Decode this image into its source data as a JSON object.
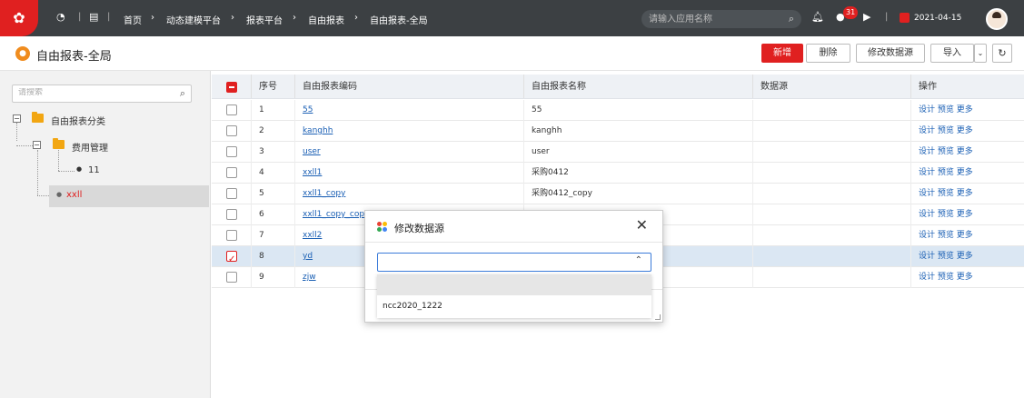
{
  "topbar": {
    "breadcrumbs": [
      "首页",
      "动态建模平台",
      "报表平台",
      "自由报表",
      "自由报表-全局"
    ],
    "search_placeholder": "请输入应用名称",
    "notif_count": "31",
    "date": "2021-04-15"
  },
  "header": {
    "title": "自由报表-全局",
    "buttons": {
      "add": "新增",
      "delete": "删除",
      "modify_ds": "修改数据源",
      "import": "导入"
    }
  },
  "tree": {
    "search_placeholder": "请搜索",
    "root": "自由报表分类",
    "child": "费用管理",
    "leaf": "11",
    "selected": "xxll"
  },
  "table": {
    "headers": [
      "序号",
      "自由报表编码",
      "自由报表名称",
      "数据源",
      "操作"
    ],
    "op_labels": [
      "设计",
      "预览",
      "更多"
    ],
    "rows": [
      {
        "no": "1",
        "code": "55",
        "name": "55"
      },
      {
        "no": "2",
        "code": "kanghh",
        "name": "kanghh"
      },
      {
        "no": "3",
        "code": "user",
        "name": "user"
      },
      {
        "no": "4",
        "code": "xxll1",
        "name": "采购0412"
      },
      {
        "no": "5",
        "code": "xxll1_copy",
        "name": "采购0412_copy"
      },
      {
        "no": "6",
        "code": "xxll1_copy_cop",
        "name": ""
      },
      {
        "no": "7",
        "code": "xxll2",
        "name": ""
      },
      {
        "no": "8",
        "code": "yd",
        "name": ""
      },
      {
        "no": "9",
        "code": "zjw",
        "name": ""
      }
    ]
  },
  "modal": {
    "title": "修改数据源",
    "options": [
      "",
      "ncc2020_1222"
    ]
  },
  "colors": {
    "accent": "#e02020",
    "link": "#1a5fb4",
    "topbar": "#3c4043"
  }
}
